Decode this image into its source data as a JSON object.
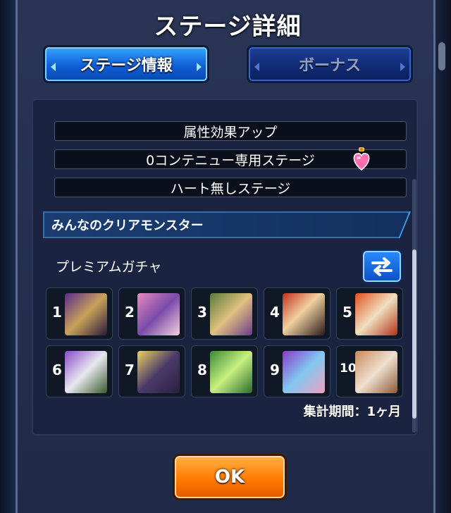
{
  "header": {
    "title": "ステージ詳細"
  },
  "tabs": [
    {
      "label": "ステージ情報",
      "active": true
    },
    {
      "label": "ボーナス",
      "active": false
    }
  ],
  "stage_info": {
    "rows": [
      "属性効果アップ",
      "0コンテニュー専用ステージ",
      "ハート無しステージ"
    ]
  },
  "clear_monsters": {
    "section_title": "みんなのクリアモンスター",
    "gacha_label": "プレミアムガチャ",
    "ranks": [
      "1",
      "2",
      "3",
      "4",
      "5",
      "6",
      "7",
      "8",
      "9",
      "10"
    ],
    "period": "集計期間：1ヶ月"
  },
  "ok_label": "OK",
  "colors": {
    "accent_blue": "#1a6fe0",
    "ok_orange": "#ff7a00",
    "panel": "#1f2a48"
  }
}
